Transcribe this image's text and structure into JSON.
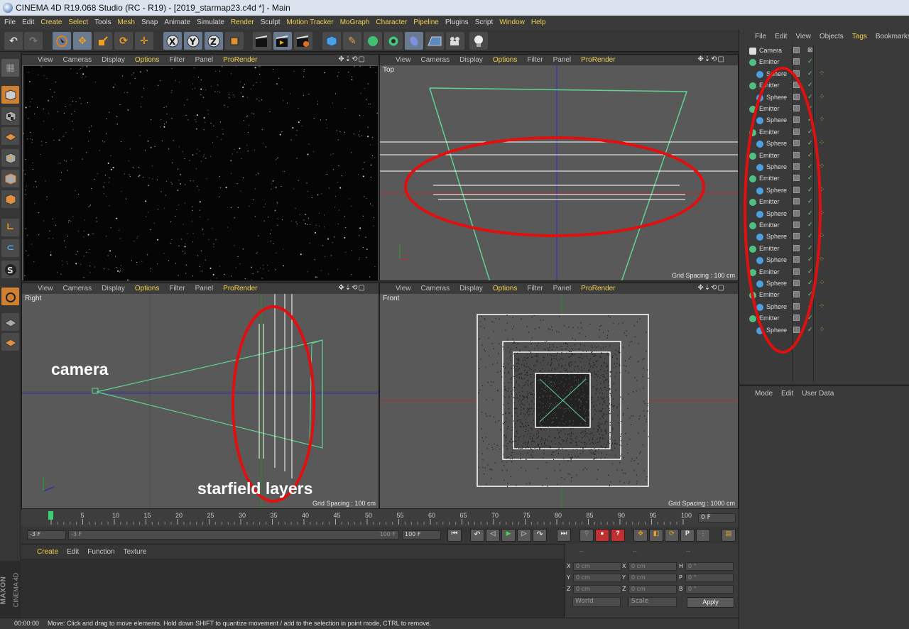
{
  "window": {
    "title": "CINEMA 4D R19.068 Studio (RC - R19) - [2019_starmap23.c4d *] - Main"
  },
  "menu": {
    "items": [
      "File",
      "Edit",
      "Create",
      "Select",
      "Tools",
      "Mesh",
      "Snap",
      "Animate",
      "Simulate",
      "Render",
      "Sculpt",
      "Motion Tracker",
      "MoGraph",
      "Character",
      "Pipeline",
      "Plugins",
      "Script",
      "Window",
      "Help"
    ]
  },
  "viewport_menu": {
    "view": "View",
    "cameras": "Cameras",
    "display": "Display",
    "options": "Options",
    "filter": "Filter",
    "panel": "Panel",
    "prorender": "ProRender"
  },
  "viewports": {
    "top": {
      "label": "Top",
      "grid": "Grid Spacing : 100 cm"
    },
    "right": {
      "label": "Right",
      "grid": "Grid Spacing : 100 cm"
    },
    "front": {
      "label": "Front",
      "grid": "Grid Spacing : 1000 cm"
    }
  },
  "annotations": {
    "camera": "camera",
    "starfield": "starfield layers"
  },
  "object_manager": {
    "menu": [
      "File",
      "Edit",
      "View",
      "Objects",
      "Tags",
      "Bookmarks"
    ],
    "objects": [
      {
        "name": "Camera",
        "type": "camera",
        "indent": 0
      },
      {
        "name": "Emitter",
        "type": "emitter",
        "indent": 0
      },
      {
        "name": "Sphere",
        "type": "sphere",
        "indent": 1
      },
      {
        "name": "Emitter",
        "type": "emitter",
        "indent": 0
      },
      {
        "name": "Sphere",
        "type": "sphere",
        "indent": 1
      },
      {
        "name": "Emitter",
        "type": "emitter",
        "indent": 0
      },
      {
        "name": "Sphere",
        "type": "sphere",
        "indent": 1
      },
      {
        "name": "Emitter",
        "type": "emitter",
        "indent": 0
      },
      {
        "name": "Sphere",
        "type": "sphere",
        "indent": 1
      },
      {
        "name": "Emitter",
        "type": "emitter",
        "indent": 0
      },
      {
        "name": "Sphere",
        "type": "sphere",
        "indent": 1
      },
      {
        "name": "Emitter",
        "type": "emitter",
        "indent": 0
      },
      {
        "name": "Sphere",
        "type": "sphere",
        "indent": 1
      },
      {
        "name": "Emitter",
        "type": "emitter",
        "indent": 0
      },
      {
        "name": "Sphere",
        "type": "sphere",
        "indent": 1
      },
      {
        "name": "Emitter",
        "type": "emitter",
        "indent": 0
      },
      {
        "name": "Sphere",
        "type": "sphere",
        "indent": 1
      },
      {
        "name": "Emitter",
        "type": "emitter",
        "indent": 0
      },
      {
        "name": "Sphere",
        "type": "sphere",
        "indent": 1
      },
      {
        "name": "Emitter",
        "type": "emitter",
        "indent": 0
      },
      {
        "name": "Sphere",
        "type": "sphere",
        "indent": 1
      },
      {
        "name": "Emitter",
        "type": "emitter",
        "indent": 0
      },
      {
        "name": "Sphere",
        "type": "sphere",
        "indent": 1
      },
      {
        "name": "Emitter",
        "type": "emitter",
        "indent": 0
      },
      {
        "name": "Sphere",
        "type": "sphere",
        "indent": 1
      }
    ]
  },
  "attribute_manager": {
    "menu": [
      "Mode",
      "Edit",
      "User Data"
    ]
  },
  "timeline": {
    "ticks": [
      "0",
      "5",
      "10",
      "15",
      "20",
      "25",
      "30",
      "35",
      "40",
      "45",
      "50",
      "55",
      "60",
      "65",
      "70",
      "75",
      "80",
      "85",
      "90",
      "95",
      "100"
    ],
    "current_frame": "0 F",
    "playhead_frame": 0
  },
  "transport": {
    "start": "-3 F",
    "range_start": "-3 F",
    "range_end": "100 F",
    "end": "100 F"
  },
  "material_manager": {
    "menu": [
      "Create",
      "Edit",
      "Function",
      "Texture"
    ]
  },
  "coordinates": {
    "headers": [
      "--",
      "--",
      "--"
    ],
    "rows": [
      {
        "a": "X",
        "av": "0 cm",
        "b": "X",
        "bv": "0 cm",
        "c": "H",
        "cv": "0 °"
      },
      {
        "a": "Y",
        "av": "0 cm",
        "b": "Y",
        "bv": "0 cm",
        "c": "P",
        "cv": "0 °"
      },
      {
        "a": "Z",
        "av": "0 cm",
        "b": "Z",
        "bv": "0 cm",
        "c": "B",
        "cv": "0 °"
      }
    ],
    "space": "World",
    "mode": "Scale",
    "apply": "Apply"
  },
  "logo": {
    "brand": "MAXON",
    "product": "CINEMA 4D"
  },
  "status": {
    "time": "00:00:00",
    "message": "Move: Click and drag to move elements. Hold down SHIFT to quantize movement / add to the selection in point mode, CTRL to remove."
  },
  "colors": {
    "accent_text": "#f2d04a",
    "annotation_ring": "#e01010",
    "wire_green": "#5fd490",
    "axis_blue": "#2020c8",
    "axis_red": "#c82020"
  }
}
